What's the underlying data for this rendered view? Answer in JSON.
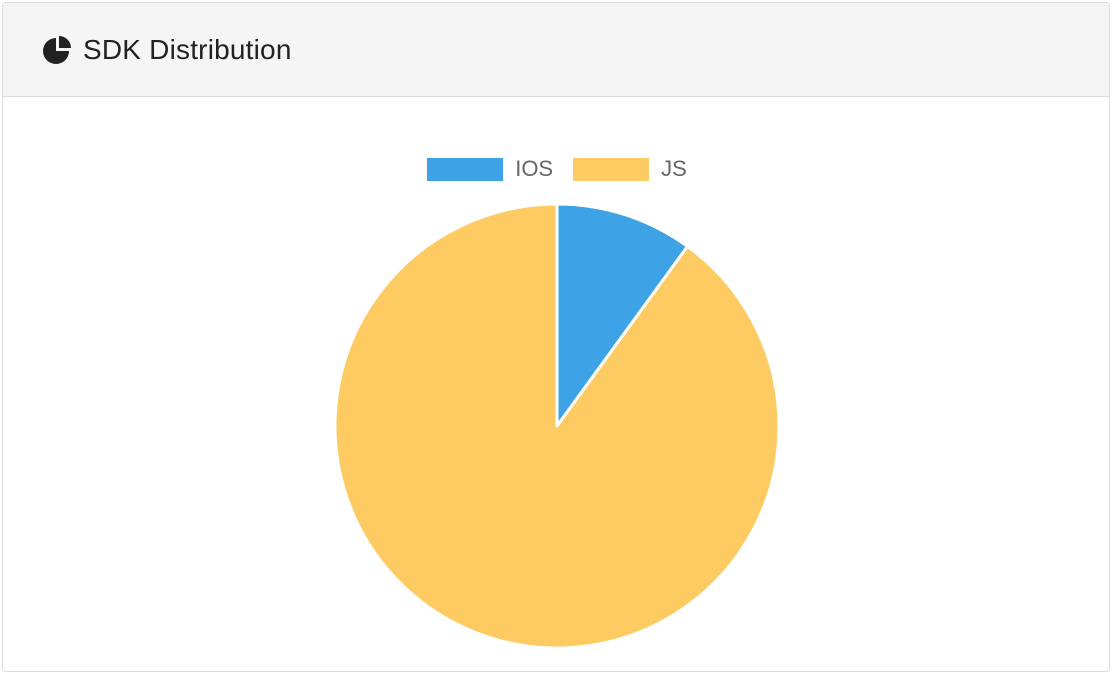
{
  "panel": {
    "title": "SDK Distribution",
    "icon": "pie-chart-icon"
  },
  "chart_data": {
    "type": "pie",
    "title": "",
    "categories": [
      "IOS",
      "JS"
    ],
    "values": [
      10,
      90
    ],
    "colors": [
      "#3ea3e6",
      "#fdcb62"
    ],
    "legend_position": "top",
    "start_angle": "top, clockwise",
    "slice_border_color": "#ffffff"
  }
}
